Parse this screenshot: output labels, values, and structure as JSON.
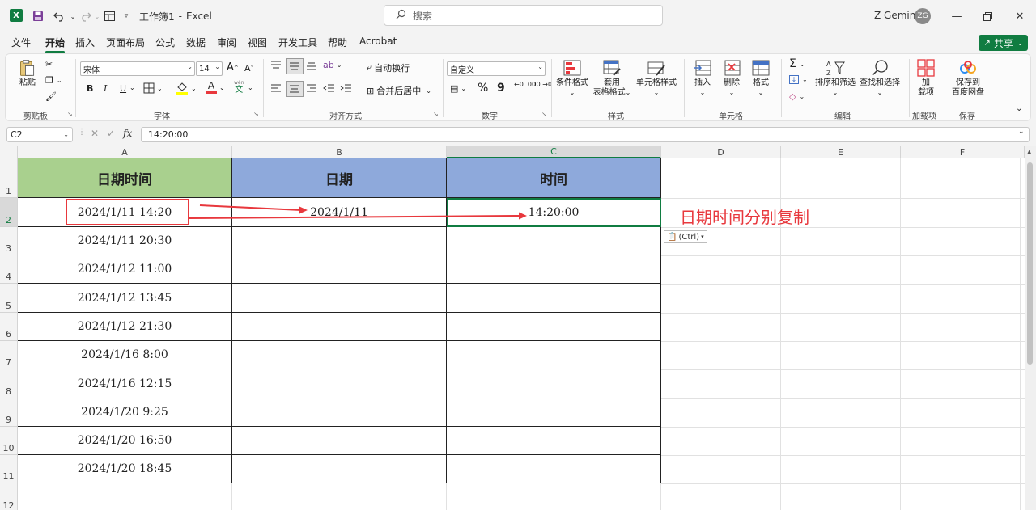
{
  "titlebar": {
    "app_icon": "X",
    "file_name": "工作簿1",
    "separator": "-",
    "app_name": "Excel",
    "search_placeholder": "搜索",
    "user_name": "Z Gemini",
    "user_initials": "ZG"
  },
  "menu": {
    "items": [
      "文件",
      "开始",
      "插入",
      "页面布局",
      "公式",
      "数据",
      "审阅",
      "视图",
      "开发工具",
      "帮助",
      "Acrobat"
    ],
    "active": "开始",
    "share_label": "共享"
  },
  "ribbon": {
    "clipboard": {
      "paste": "粘贴",
      "label": "剪贴板"
    },
    "font": {
      "name": "宋体",
      "size": "14",
      "bold": "B",
      "italic": "I",
      "underline": "U",
      "label": "字体",
      "grow": "A",
      "shrink": "A",
      "color_letter": "A",
      "wen": "wén",
      "wen_char": "文"
    },
    "alignment": {
      "wrap": "自动换行",
      "merge": "合并后居中",
      "label": "对齐方式"
    },
    "number": {
      "format": "自定义",
      "percent": "%",
      "comma": "9",
      "label": "数字",
      "inc": "←0 .00",
      "dec": ".00 →0"
    },
    "styles": {
      "conditional": "条件格式",
      "table_line1": "套用",
      "table_line2": "表格格式",
      "cell_style": "单元格样式",
      "label": "样式"
    },
    "cells": {
      "insert": "插入",
      "delete": "删除",
      "format": "格式",
      "label": "单元格"
    },
    "editing": {
      "sum": "Σ",
      "sort": "排序和筛选",
      "find": "查找和选择",
      "label": "编辑"
    },
    "addins": {
      "line1": "加",
      "line2": "载项",
      "label": "加载项"
    },
    "save": {
      "line1": "保存到",
      "line2": "百度网盘",
      "label": "保存"
    }
  },
  "formula_bar": {
    "name_box": "C2",
    "fx": "fx",
    "value": "14:20:00"
  },
  "sheet": {
    "columns": [
      "A",
      "B",
      "C",
      "D",
      "E",
      "F"
    ],
    "selected_column": "C",
    "row_numbers": [
      "1",
      "2",
      "3",
      "4",
      "5",
      "6",
      "7",
      "8",
      "9",
      "10",
      "11",
      "12"
    ],
    "headers": [
      "日期时间",
      "日期",
      "时间"
    ],
    "datetimes": [
      "2024/1/11  14:20",
      "2024/1/11  20:30",
      "2024/1/12  11:00",
      "2024/1/12  13:45",
      "2024/1/12  21:30",
      "2024/1/16  8:00",
      "2024/1/16  12:15",
      "2024/1/20  9:25",
      "2024/1/20  16:50",
      "2024/1/20  18:45"
    ],
    "b2": "2024/1/11",
    "c2": "14:20:00",
    "paste_options": "(Ctrl)",
    "annotation": "日期时间分别复制"
  },
  "colors": {
    "accent": "#107c41",
    "header_green": "#a9d08e",
    "header_blue": "#8ea9db",
    "annotation_red": "#e8383d"
  }
}
